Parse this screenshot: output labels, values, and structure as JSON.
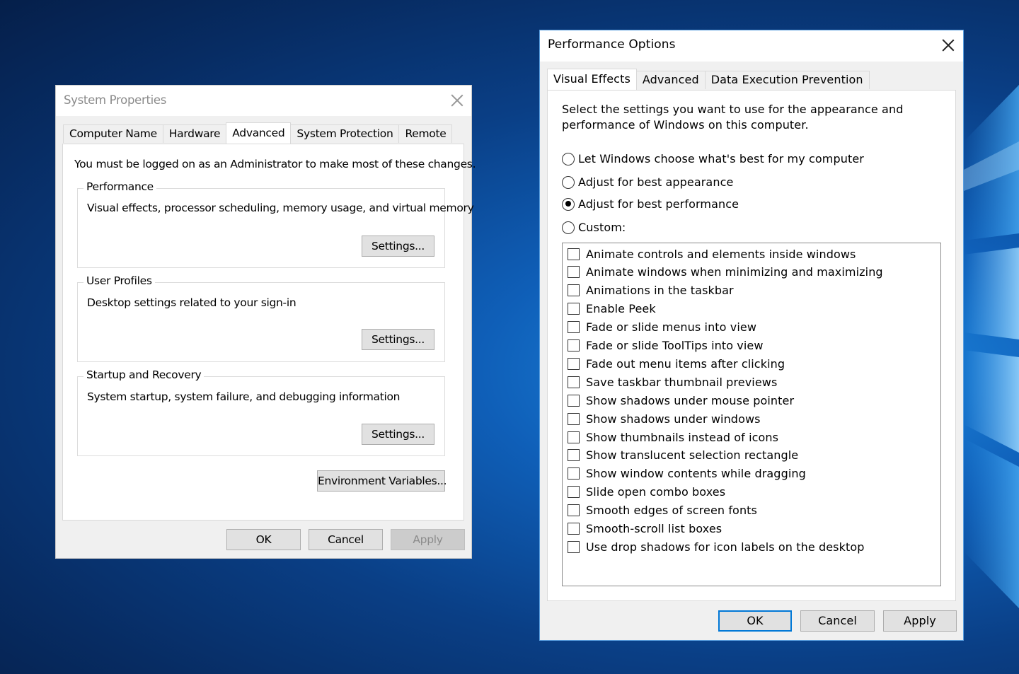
{
  "system_properties": {
    "title": "System Properties",
    "tabs": [
      {
        "label": "Computer Name",
        "active": false
      },
      {
        "label": "Hardware",
        "active": false
      },
      {
        "label": "Advanced",
        "active": true
      },
      {
        "label": "System Protection",
        "active": false
      },
      {
        "label": "Remote",
        "active": false
      }
    ],
    "notice": "You must be logged on as an Administrator to make most of these changes.",
    "groups": [
      {
        "title": "Performance",
        "description": "Visual effects, processor scheduling, memory usage, and virtual memory",
        "button": "Settings..."
      },
      {
        "title": "User Profiles",
        "description": "Desktop settings related to your sign-in",
        "button": "Settings..."
      },
      {
        "title": "Startup and Recovery",
        "description": "System startup, system failure, and debugging information",
        "button": "Settings..."
      }
    ],
    "env_button": "Environment Variables...",
    "buttons": {
      "ok": "OK",
      "cancel": "Cancel",
      "apply": "Apply",
      "apply_enabled": false
    }
  },
  "performance_options": {
    "title": "Performance Options",
    "tabs": [
      {
        "label": "Visual Effects",
        "active": true
      },
      {
        "label": "Advanced",
        "active": false
      },
      {
        "label": "Data Execution Prevention",
        "active": false
      }
    ],
    "intro": "Select the settings you want to use for the appearance and performance of Windows on this computer.",
    "radio_options": [
      {
        "label": "Let Windows choose what's best for my computer",
        "checked": false
      },
      {
        "label": "Adjust for best appearance",
        "checked": false
      },
      {
        "label": "Adjust for best performance",
        "checked": true
      },
      {
        "label": "Custom:",
        "checked": false
      }
    ],
    "effects": [
      {
        "label": "Animate controls and elements inside windows",
        "checked": false
      },
      {
        "label": "Animate windows when minimizing and maximizing",
        "checked": false
      },
      {
        "label": "Animations in the taskbar",
        "checked": false
      },
      {
        "label": "Enable Peek",
        "checked": false
      },
      {
        "label": "Fade or slide menus into view",
        "checked": false
      },
      {
        "label": "Fade or slide ToolTips into view",
        "checked": false
      },
      {
        "label": "Fade out menu items after clicking",
        "checked": false
      },
      {
        "label": "Save taskbar thumbnail previews",
        "checked": false
      },
      {
        "label": "Show shadows under mouse pointer",
        "checked": false
      },
      {
        "label": "Show shadows under windows",
        "checked": false
      },
      {
        "label": "Show thumbnails instead of icons",
        "checked": false
      },
      {
        "label": "Show translucent selection rectangle",
        "checked": false
      },
      {
        "label": "Show window contents while dragging",
        "checked": false
      },
      {
        "label": "Slide open combo boxes",
        "checked": false
      },
      {
        "label": "Smooth edges of screen fonts",
        "checked": false
      },
      {
        "label": "Smooth-scroll list boxes",
        "checked": false
      },
      {
        "label": "Use drop shadows for icon labels on the desktop",
        "checked": false
      }
    ],
    "buttons": {
      "ok": "OK",
      "cancel": "Cancel",
      "apply": "Apply"
    }
  },
  "colors": {
    "desktop_dark": "#051f4a",
    "desktop_light": "#1f8ee6",
    "accent": "#0078d7",
    "dialog_bg": "#f0f0f0"
  }
}
